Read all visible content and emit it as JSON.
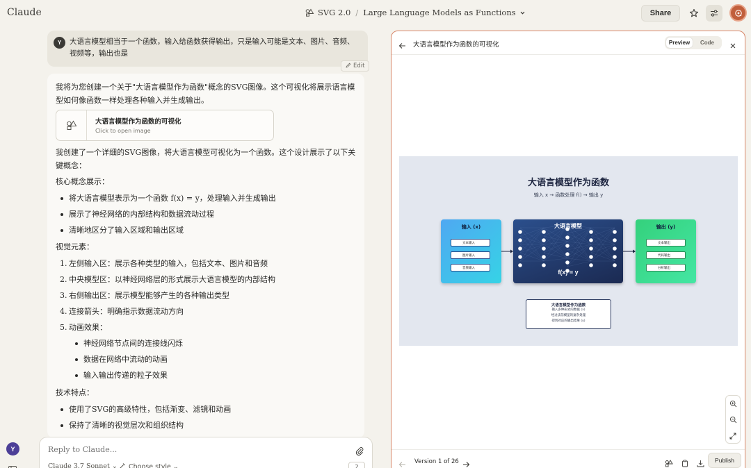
{
  "app": {
    "logo": "Claude"
  },
  "breadcrumb": {
    "project": "SVG 2.0",
    "separator": "/",
    "conversation": "Large Language Models as Functions"
  },
  "header": {
    "share_label": "Share"
  },
  "user_message": {
    "avatar": "Y",
    "text": "大语言模型相当于一个函数，输入给函数获得输出，只是输入可能是文本、图片、音频、视频等，输出也是",
    "edit_label": "Edit"
  },
  "assistant": {
    "intro": "我将为您创建一个关于\"大语言模型作为函数\"概念的SVG图像。这个可视化将展示语言模型如何像函数一样处理各种输入并生成输出。",
    "artifact_card": {
      "title": "大语言模型作为函数的可视化",
      "subtitle": "Click to open image"
    },
    "summary": "我创建了一个详细的SVG图像，将大语言模型可视化为一个函数。这个设计展示了以下关键概念：",
    "core_heading": "核心概念展示：",
    "core_items": [
      "将大语言模型表示为一个函数 f(x) = y，处理输入并生成输出",
      "展示了神经网络的内部结构和数据流动过程",
      "清晰地区分了输入区域和输出区域"
    ],
    "visual_heading": "视觉元素：",
    "visual_items": [
      {
        "n": "1.",
        "text": "左侧输入区：展示各种类型的输入，包括文本、图片和音频"
      },
      {
        "n": "2.",
        "text": "中央模型区：以神经网络层的形式展示大语言模型的内部结构"
      },
      {
        "n": "3.",
        "text": "右侧输出区：展示模型能够产生的各种输出类型"
      },
      {
        "n": "4.",
        "text": "连接箭头：明确指示数据流动方向"
      },
      {
        "n": "5.",
        "text": "动画效果："
      }
    ],
    "animation_items": [
      "神经网络节点间的连接线闪烁",
      "数据在网络中流动的动画",
      "输入输出传递的粒子效果"
    ],
    "tech_heading": "技术特点：",
    "tech_items": [
      "使用了SVG的高级特性，包括渐变、滤镜和动画",
      "保持了清晰的视觉层次和组织结构"
    ]
  },
  "sidebar": {
    "user_avatar": "Y"
  },
  "composer": {
    "placeholder": "Reply to Claude...",
    "model": "Claude 3.7 Sonnet ⌄",
    "style": "Choose style ⌄",
    "badge": "2"
  },
  "panel": {
    "title": "大语言模型作为函数的可视化",
    "toggle_preview": "Preview",
    "toggle_code": "Code",
    "version": "Version 1 of 26",
    "publish": "Publish"
  },
  "figure": {
    "title": "大语言模型作为函数",
    "subtitle": "输入 x → 函数处理 f() → 输出 y",
    "input_label": "输入 (x)",
    "model_label": "大语言模型",
    "output_label": "输出 (y)",
    "inputs": [
      "文本输入",
      "图片输入",
      "音频输入"
    ],
    "outputs": [
      "文本输出",
      "代码输出",
      "分析输出"
    ],
    "formula": "f(x) = y",
    "legend_title": "大语言模型作为函数",
    "legend_lines": [
      "输入多种形式的数据 (x)",
      "经过该前模型的复杂处理",
      "得到对应的输出结果 (y)"
    ]
  },
  "colors": {
    "accent": "#c15f3c",
    "panel_border": "#d88568",
    "input_box": "#4fa8f2",
    "model_box": "#1b2a52",
    "output_box": "#34d17c"
  }
}
